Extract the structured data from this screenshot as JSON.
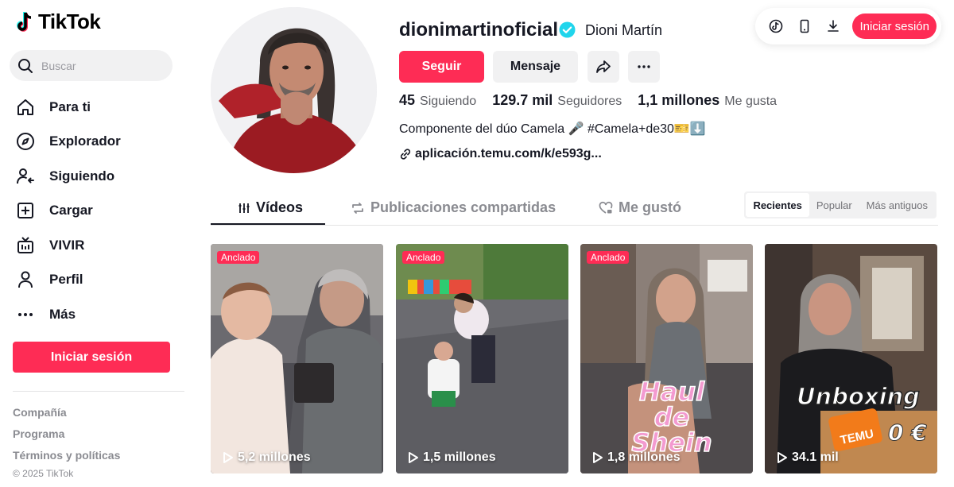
{
  "app": {
    "name": "TikTok"
  },
  "search": {
    "placeholder": "Buscar"
  },
  "nav": [
    {
      "label": "Para ti",
      "icon": "home-icon"
    },
    {
      "label": "Explorador",
      "icon": "compass-icon"
    },
    {
      "label": "Siguiendo",
      "icon": "following-icon"
    },
    {
      "label": "Cargar",
      "icon": "upload-icon"
    },
    {
      "label": "VIVIR",
      "icon": "live-icon"
    },
    {
      "label": "Perfil",
      "icon": "profile-icon"
    },
    {
      "label": "Más",
      "icon": "more-icon"
    }
  ],
  "sidebar": {
    "login_label": "Iniciar sesión"
  },
  "footer": {
    "links": [
      "Compañía",
      "Programa",
      "Términos y políticas"
    ],
    "copyright": "© 2025 TikTok"
  },
  "topbar": {
    "login_label": "Iniciar sesión"
  },
  "profile": {
    "username": "dionimartinoficial",
    "nickname": "Dioni Martín",
    "follow_label": "Seguir",
    "message_label": "Mensaje",
    "stats": {
      "following": {
        "value": "45",
        "label": "Siguiendo"
      },
      "followers": {
        "value": "129.7 mil",
        "label": "Seguidores"
      },
      "likes": {
        "value": "1,1 millones",
        "label": "Me gusta"
      }
    },
    "bio": "Componente del dúo Camela 🎤 #Camela+de30🎫⬇️",
    "link": "aplicación.temu.com/k/e593g..."
  },
  "tabs": [
    {
      "label": "Vídeos",
      "active": true
    },
    {
      "label": "Publicaciones compartidas",
      "active": false
    },
    {
      "label": "Me gustó",
      "active": false
    }
  ],
  "sort": [
    {
      "label": "Recientes",
      "active": true
    },
    {
      "label": "Popular",
      "active": false
    },
    {
      "label": "Más antiguos",
      "active": false
    }
  ],
  "videos": [
    {
      "pinned_label": "Anclado",
      "views": "5,2 millones",
      "overlay": ""
    },
    {
      "pinned_label": "Anclado",
      "views": "1,5 millones",
      "overlay": ""
    },
    {
      "pinned_label": "Anclado",
      "views": "1,8 millones",
      "overlay": "Haul de Shein"
    },
    {
      "pinned_label": "",
      "views": "34.1 mil",
      "overlay": "Unboxing",
      "overlay_badge": "TEMU",
      "overlay_price": "0 €"
    }
  ],
  "colors": {
    "accent": "#fe2c55",
    "verified": "#20d5ec",
    "text": "#161823",
    "muted": "#8a8b91"
  }
}
